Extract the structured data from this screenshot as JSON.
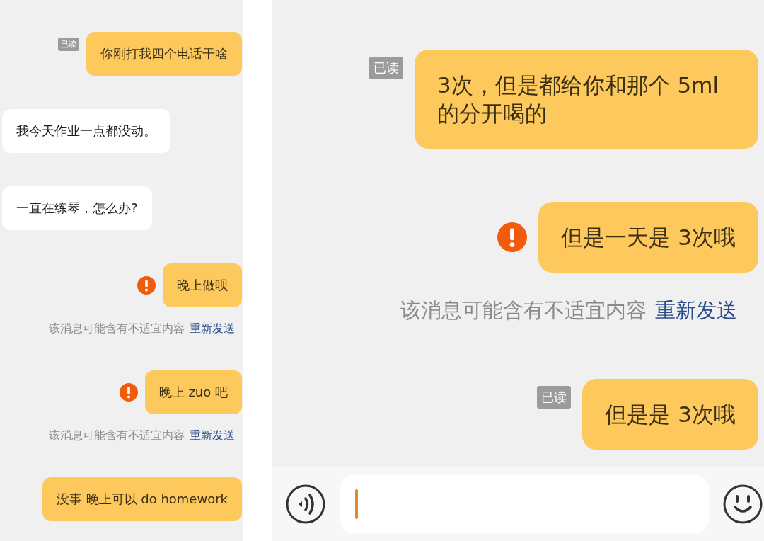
{
  "panels": [
    {
      "messages": [
        {
          "kind": "sent",
          "text": "你刚打我四个电话干啥",
          "read_label": "已读",
          "failed": false
        },
        {
          "kind": "received",
          "text": "我今天作业一点都没动。"
        },
        {
          "kind": "received",
          "text": "一直在练琴，怎么办?"
        },
        {
          "kind": "sent",
          "text": "晚上做呗",
          "failed": true,
          "notice": "该消息可能含有不适宜内容",
          "action": "重新发送"
        },
        {
          "kind": "sent",
          "text": "晚上 zuo 吧",
          "failed": true,
          "notice": "该消息可能含有不适宜内容",
          "action": "重新发送"
        },
        {
          "kind": "sent",
          "text": "没事 晚上可以 do homework",
          "failed": false
        }
      ]
    },
    {
      "messages": [
        {
          "kind": "sent",
          "text": "3次，但是都给你和那个 5ml 的分开喝的",
          "read_label": "已读",
          "failed": false
        },
        {
          "kind": "sent",
          "text": "但是一天是 3次哦",
          "failed": true,
          "notice": "该消息可能含有不适宜内容",
          "action": "重新发送"
        },
        {
          "kind": "sent",
          "text": "但是是 3次哦",
          "read_label": "已读",
          "failed": false
        }
      ],
      "input_bar": {
        "focused": true
      }
    }
  ]
}
